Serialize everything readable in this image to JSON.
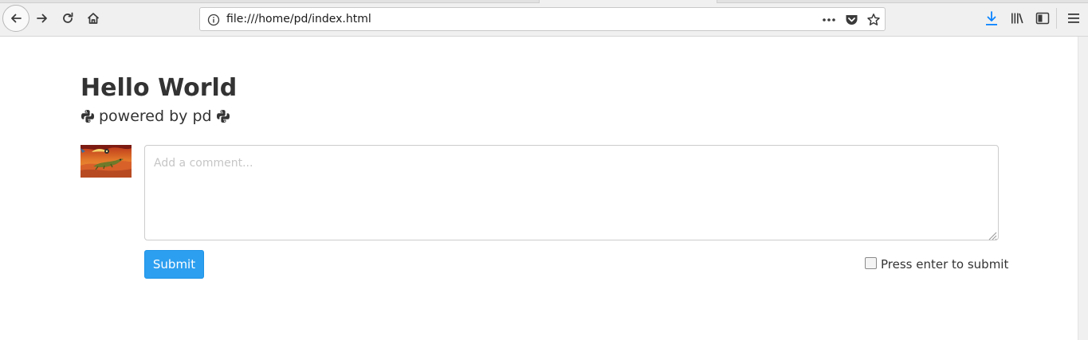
{
  "browser": {
    "url": "file:///home/pd/index.html",
    "icons": {
      "back": "back-arrow-icon",
      "forward": "forward-arrow-icon",
      "reload": "reload-icon",
      "home": "home-icon",
      "site_info": "info-icon",
      "page_actions": "more-dots-icon",
      "pocket": "pocket-icon",
      "bookmark": "star-icon",
      "downloads": "download-icon",
      "library": "library-icon",
      "sidebar": "sidebar-icon",
      "menu": "hamburger-menu-icon"
    },
    "accent_color": "#0a84ff"
  },
  "page": {
    "title": "Hello World",
    "subtitle": "powered by pd",
    "subtitle_icon": "python-logo-icon"
  },
  "comment_form": {
    "placeholder": "Add a comment...",
    "value": "",
    "submit_label": "Submit",
    "enter_to_submit_label": "Press enter to submit",
    "enter_to_submit_checked": false,
    "submit_color": "#2d9ff0"
  }
}
